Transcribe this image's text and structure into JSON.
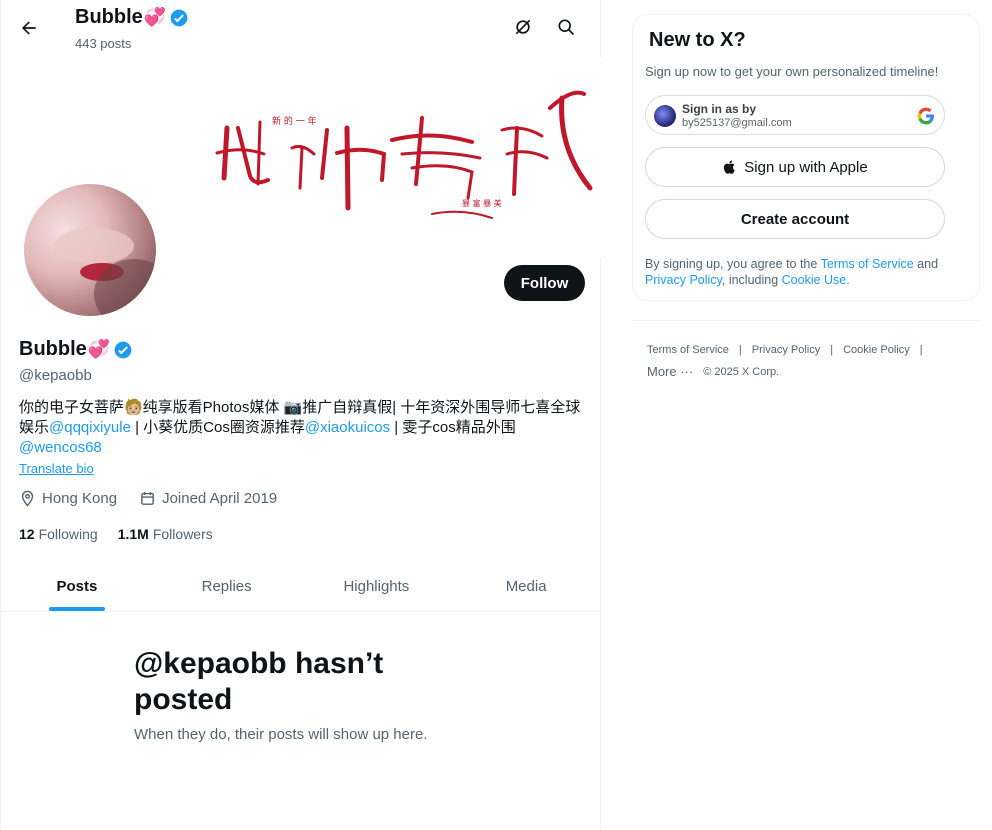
{
  "topbar": {
    "name": "Bubble",
    "posts_count": "443 posts"
  },
  "profile": {
    "name": "Bubble",
    "handle": "@kepaobb",
    "bio_part1": "你的电子女菩萨🧑🏼纯享版看Photos媒体 📷推广自辩真假| 十年资深外围导师七喜全球娱乐",
    "bio_link1": "@qqqixiyule",
    "bio_part2": " | 小葵优质Cos圈资源推荐",
    "bio_link2": "@xiaokuicos",
    "bio_part3": " | 雯子cos精品外围",
    "bio_link3": "@wencos68",
    "translate": "Translate bio",
    "location": "Hong Kong",
    "joined": "Joined April 2019",
    "following_count": "12",
    "following_label": "Following",
    "followers_count": "1.1M",
    "followers_label": "Followers",
    "follow_button": "Follow"
  },
  "tabs": [
    {
      "label": "Posts",
      "active": true
    },
    {
      "label": "Replies",
      "active": false
    },
    {
      "label": "Highlights",
      "active": false
    },
    {
      "label": "Media",
      "active": false
    }
  ],
  "empty": {
    "title": "@kepaobb hasn’t posted",
    "subtitle": "When they do, their posts will show up here."
  },
  "signup": {
    "title": "New to X?",
    "subtitle": "Sign up now to get your own personalized timeline!",
    "google_line1": "Sign in as by",
    "google_line2": "by525137@gmail.com",
    "apple_label": "Sign up with Apple",
    "create_label": "Create account",
    "legal_prefix": "By signing up, you agree to the ",
    "terms": "Terms of Service",
    "legal_and": " and ",
    "privacy": "Privacy Policy",
    "legal_including": ", including ",
    "cookie": "Cookie Use."
  },
  "footer": {
    "links": [
      "Terms of Service",
      "Privacy Policy",
      "Cookie Policy"
    ],
    "more": "More ···",
    "copyright": "© 2025 X Corp."
  },
  "colors": {
    "accent": "#1d9bf0",
    "text": "#0f1419",
    "secondary": "#536471",
    "banner_ink": "#c0182a"
  }
}
